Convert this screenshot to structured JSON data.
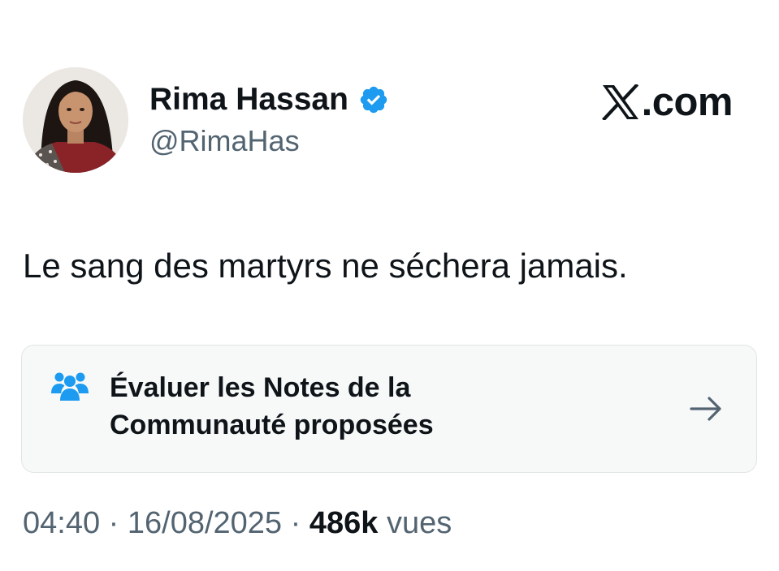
{
  "author": {
    "display_name": "Rima Hassan",
    "handle": "@RimaHas",
    "verified": true,
    "avatar_icon": "profile-photo"
  },
  "brand": {
    "domain": ".com",
    "logo_icon": "x-logo-icon"
  },
  "tweet": {
    "text": "Le sang des martyrs ne séchera jamais."
  },
  "community_notes": {
    "label": "Évaluer les Notes de la Communauté proposées",
    "icon": "people-icon",
    "icon_color": "#1d9bf0",
    "action_icon": "arrow-right-icon"
  },
  "meta": {
    "time": "04:40",
    "separator": "·",
    "date": "16/08/2025",
    "views_count": "486k",
    "views_label": "vues"
  },
  "colors": {
    "text_primary": "#0f1419",
    "text_secondary": "#536471",
    "verified_badge": "#1d9bf0",
    "card_background": "#f7f9f9"
  }
}
